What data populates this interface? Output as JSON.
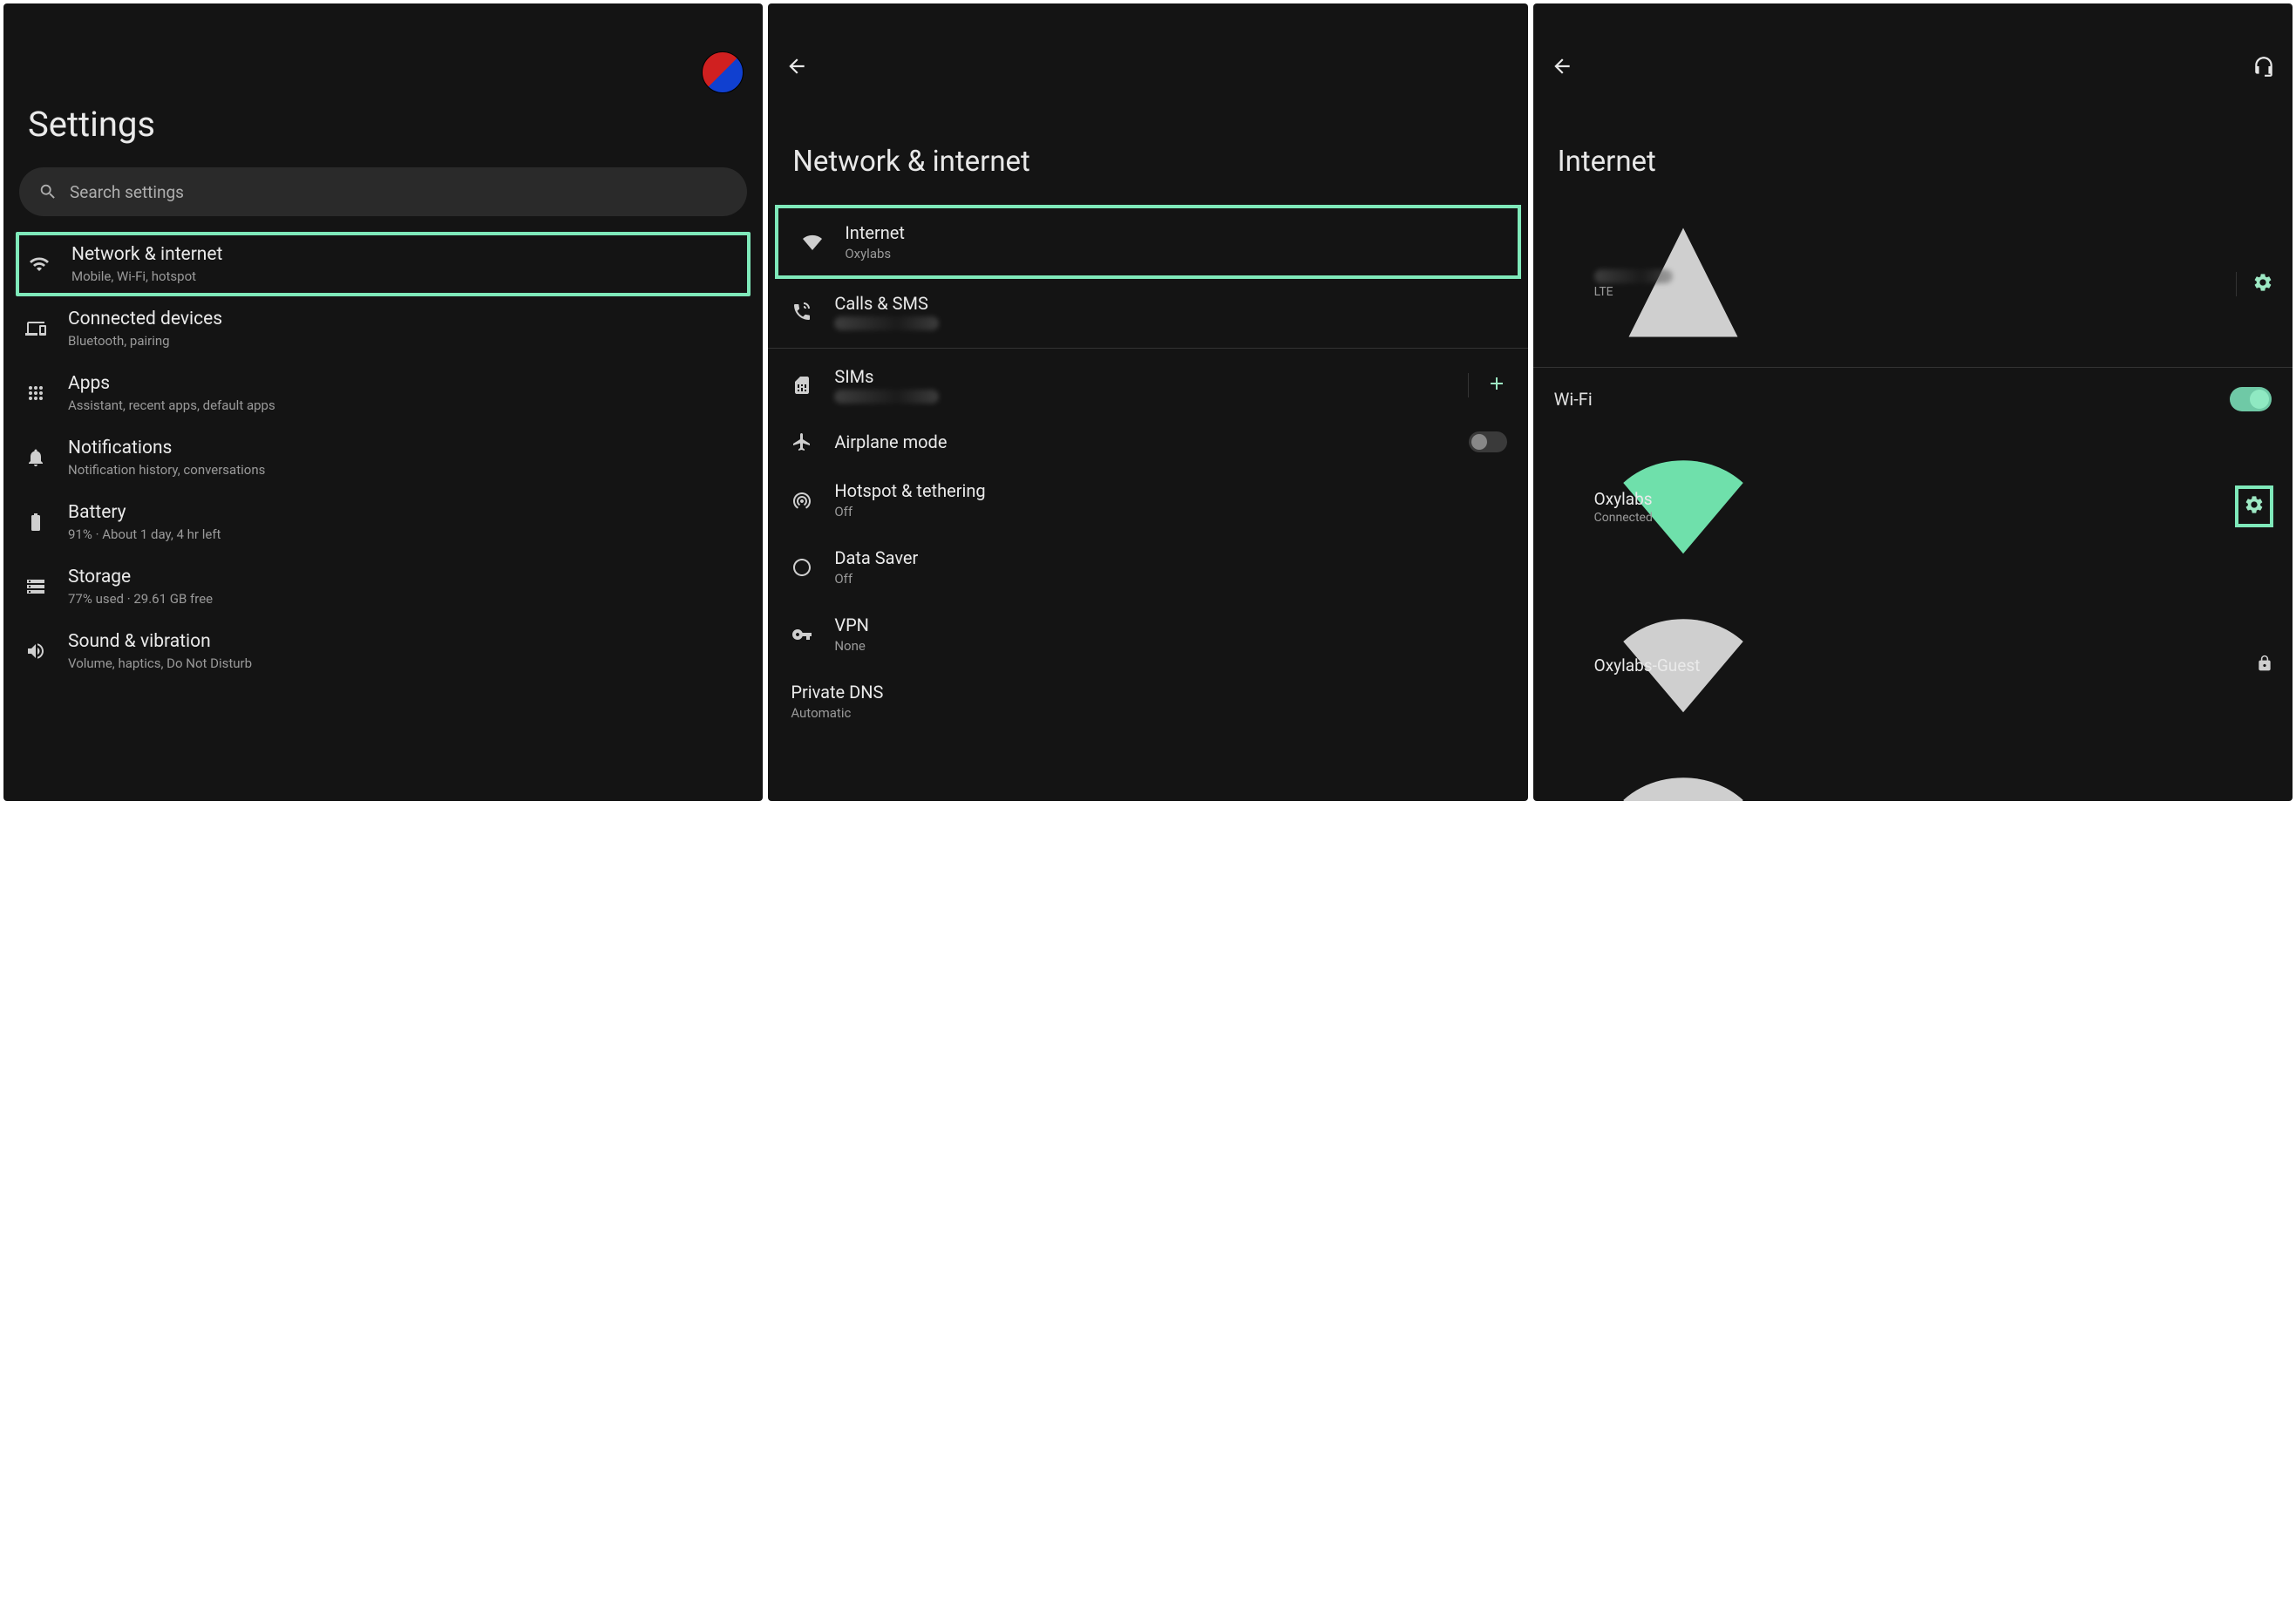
{
  "panel1": {
    "title": "Settings",
    "search_placeholder": "Search settings",
    "items": [
      {
        "title": "Network & internet",
        "sub": "Mobile, Wi-Fi, hotspot",
        "icon": "wifi"
      },
      {
        "title": "Connected devices",
        "sub": "Bluetooth, pairing",
        "icon": "devices"
      },
      {
        "title": "Apps",
        "sub": "Assistant, recent apps, default apps",
        "icon": "grid"
      },
      {
        "title": "Notifications",
        "sub": "Notification history, conversations",
        "icon": "bell"
      },
      {
        "title": "Battery",
        "sub": "91% · About 1 day, 4 hr left",
        "icon": "battery"
      },
      {
        "title": "Storage",
        "sub": "77% used · 29.61 GB free",
        "icon": "storage"
      },
      {
        "title": "Sound & vibration",
        "sub": "Volume, haptics, Do Not Disturb",
        "icon": "sound"
      }
    ]
  },
  "panel2": {
    "title": "Network & internet",
    "items": [
      {
        "title": "Internet",
        "sub": "Oxylabs",
        "icon": "wifi-filled"
      },
      {
        "title": "Calls & SMS",
        "sub": "",
        "icon": "phone",
        "blurred": true
      },
      {
        "title": "SIMs",
        "sub": "",
        "icon": "sim",
        "trail": "plus",
        "blurred": true
      },
      {
        "title": "Airplane mode",
        "sub": "",
        "icon": "airplane",
        "trail": "toggle-off"
      },
      {
        "title": "Hotspot & tethering",
        "sub": "Off",
        "icon": "hotspot"
      },
      {
        "title": "Data Saver",
        "sub": "Off",
        "icon": "datasaver"
      },
      {
        "title": "VPN",
        "sub": "None",
        "icon": "vpn"
      },
      {
        "title": "Private DNS",
        "sub": "Automatic",
        "icon": ""
      }
    ]
  },
  "panel3": {
    "title": "Internet",
    "cellular": {
      "label": "LTE"
    },
    "wifi_label": "Wi-Fi",
    "connected": {
      "name": "Oxylabs",
      "status": "Connected"
    },
    "networks": [
      {
        "name": "Oxylabs-Guest",
        "locked": true
      },
      {
        "name": "",
        "locked": true,
        "blurred": true
      },
      {
        "name": "",
        "locked": true,
        "blurred": true
      },
      {
        "name": "",
        "locked": true,
        "blurred": true
      },
      {
        "name": "",
        "locked": true,
        "blurred": true
      },
      {
        "name": "",
        "locked": false,
        "blurred": true
      }
    ]
  },
  "colors": {
    "highlight": "#7fe9ba",
    "accent": "#9de8c3"
  }
}
